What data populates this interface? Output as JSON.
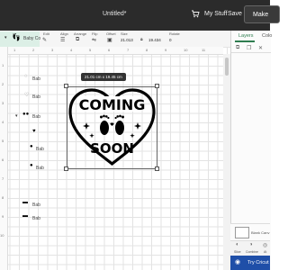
{
  "app": {
    "doc_title": "Untitled*",
    "my_stuff": "My Stuff",
    "save": "Save",
    "make": "Make"
  },
  "toolbar": {
    "operation_label": "Operation",
    "operation_value": "Basic Cut",
    "edit_label": "Edit",
    "align_label": "Align",
    "arrange_label": "Arrange",
    "flip_label": "Flip",
    "offset_label": "Offset",
    "size_label": "Size",
    "size_w": "21.013",
    "size_h": "19.434",
    "rotate_label": "Rotate",
    "color_hex": "#000000"
  },
  "canvas": {
    "ruler_top": [
      "1",
      "2",
      "3",
      "4",
      "5",
      "6",
      "7",
      "8",
      "9",
      "10",
      "11"
    ],
    "ruler_left": [
      "1",
      "2",
      "3",
      "4",
      "5",
      "6",
      "7",
      "8",
      "9",
      "10"
    ],
    "dimensions_badge": "21.01 cm x 19.45 cm",
    "design_line1": "COMING",
    "design_line2": "SOON"
  },
  "layers_panel": {
    "tab_layers": "Layers",
    "tab_color": "Colo",
    "group_name": "Baby Co",
    "layers": [
      {
        "label": "Bab"
      },
      {
        "label": "Bab"
      },
      {
        "label": "Bab"
      },
      {
        "label": "Bab"
      },
      {
        "label": "Bab"
      },
      {
        "label": "Bab"
      },
      {
        "label": "Bab"
      }
    ],
    "blank_canvas": "Blank Canv",
    "actions": [
      "Slice",
      "Combine",
      "At"
    ],
    "try_cricut": "Try Cricut"
  },
  "colors": {
    "topbar": "#2b2b2b",
    "accent_green": "#2e7d4f",
    "selected_row": "#dcefe6",
    "cta_blue": "#1f4fa8"
  }
}
